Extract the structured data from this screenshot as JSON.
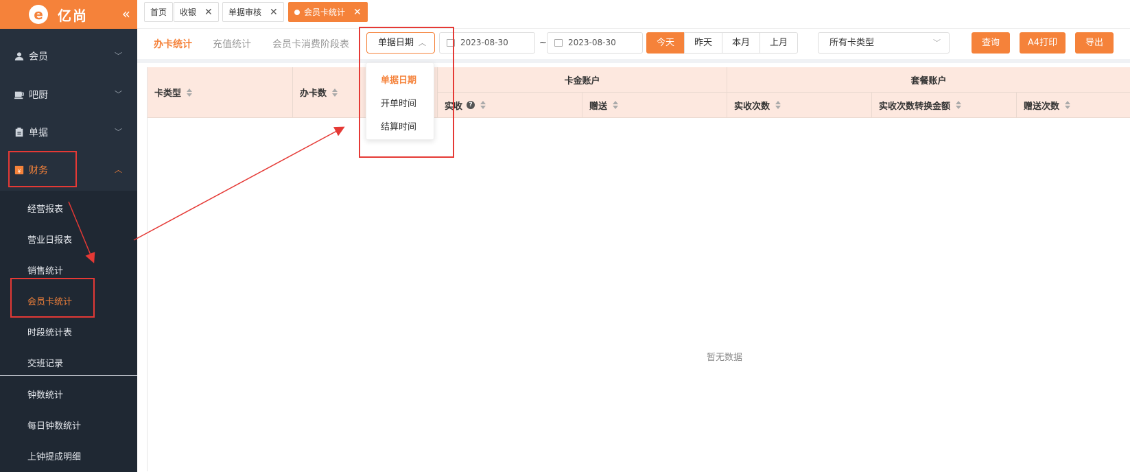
{
  "brand": {
    "logo": "e",
    "name": "亿尚",
    "collapse_icon": "double-chevron-left-icon"
  },
  "sidebar": {
    "menus": [
      {
        "label": "会员",
        "icon": "user-icon"
      },
      {
        "label": "吧厨",
        "icon": "coffee-icon"
      },
      {
        "label": "单据",
        "icon": "clipboard-icon"
      },
      {
        "label": "财务",
        "icon": "wallet-icon",
        "active": true
      }
    ],
    "submenu": [
      "经营报表",
      "营业日报表",
      "销售统计",
      "会员卡统计",
      "时段统计表",
      "交班记录",
      "钟数统计",
      "每日钟数统计",
      "上钟提成明细"
    ],
    "active_submenu": "会员卡统计"
  },
  "tabs": [
    {
      "label": "首页",
      "closable": false
    },
    {
      "label": "收银",
      "closable": true
    },
    {
      "label": "单据审核",
      "closable": true
    },
    {
      "label": "会员卡统计",
      "closable": true,
      "active": true
    }
  ],
  "toolbar": {
    "subtabs": [
      "办卡统计",
      "充值统计",
      "会员卡消费阶段表"
    ],
    "active_subtab": "办卡统计",
    "date_type": "单据日期",
    "date_from": "2023-08-30",
    "date_sep": "~",
    "date_to": "2023-08-30",
    "quick": [
      "今天",
      "昨天",
      "本月",
      "上月"
    ],
    "active_quick": "今天",
    "card_type_select": "所有卡类型",
    "query": "查询",
    "print": "A4打印",
    "export": "导出"
  },
  "dropdown": {
    "options": [
      "单据日期",
      "开单时间",
      "结算时间"
    ],
    "selected": "单据日期"
  },
  "table": {
    "group_headers": {
      "card_account": "卡金账户",
      "package_account": "套餐账户"
    },
    "columns": {
      "card_type": "卡类型",
      "card_count": "办卡数",
      "received": "实收",
      "gift": "赠送",
      "received_times": "实收次数",
      "times_to_amount": "实收次数转换金额",
      "gift_times": "赠送次数"
    },
    "empty_text": "暂无数据"
  },
  "colors": {
    "accent": "#f5823a",
    "sidebar_bg": "#26303d",
    "header_bg": "#fde8df",
    "annotation": "#e53935"
  }
}
